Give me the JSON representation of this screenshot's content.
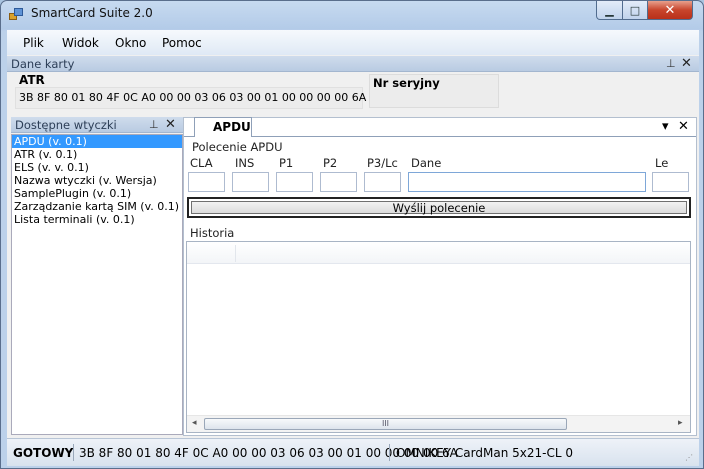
{
  "window": {
    "title": "SmartCard Suite 2.0",
    "minimize_glyph": "▁",
    "maximize_glyph": "□",
    "close_glyph": "✕"
  },
  "menu": [
    "Plik",
    "Widok",
    "Okno",
    "Pomoc"
  ],
  "card_panel": {
    "title": "Dane karty",
    "atr_label": "ATR",
    "atr_value": "3B 8F 80 01 80 4F 0C A0 00 00 03 06 03 00 01 00 00 00 00 6A",
    "serial_label": "Nr seryjny",
    "pin_glyph": "⊥",
    "close_glyph": "✕"
  },
  "plugins_panel": {
    "title": "Dostępne wtyczki",
    "pin_glyph": "⊥",
    "close_glyph": "✕",
    "items": [
      "APDU (v. 0.1)",
      "ATR (v. 0.1)",
      "ELS (v. v. 0.1)",
      "Nazwa wtyczki (v. Wersja)",
      "SamplePlugin (v. 0.1)",
      "Zarządzanie kartą SIM (v. 0.1)",
      "Lista terminali (v. 0.1)"
    ],
    "selected_index": 0
  },
  "apdu_tab": {
    "label": "APDU",
    "dropdown_glyph": "▾",
    "close_glyph": "✕",
    "command_group": "Polecenie APDU",
    "fields": {
      "cla": "CLA",
      "ins": "INS",
      "p1": "P1",
      "p2": "P2",
      "p3lc": "P3/Lc",
      "dane": "Dane",
      "le": "Le"
    },
    "send_button": "Wyślij polecenie",
    "history_label": "Historia",
    "scroll_left": "◂",
    "scroll_right": "▸",
    "scroll_grip": "III"
  },
  "statusbar": {
    "status": "GOTOWY",
    "atr": "3B 8F 80 01 80 4F 0C A0 00 00 03 06 03 00 01 00 00 00 00 6A",
    "reader": "OMNIKEY CardMan 5x21-CL 0",
    "grip": "⋰"
  },
  "colors": {
    "selection": "#3399ff",
    "panel_header": "#c3d3e8",
    "close_button": "#c8452c"
  }
}
